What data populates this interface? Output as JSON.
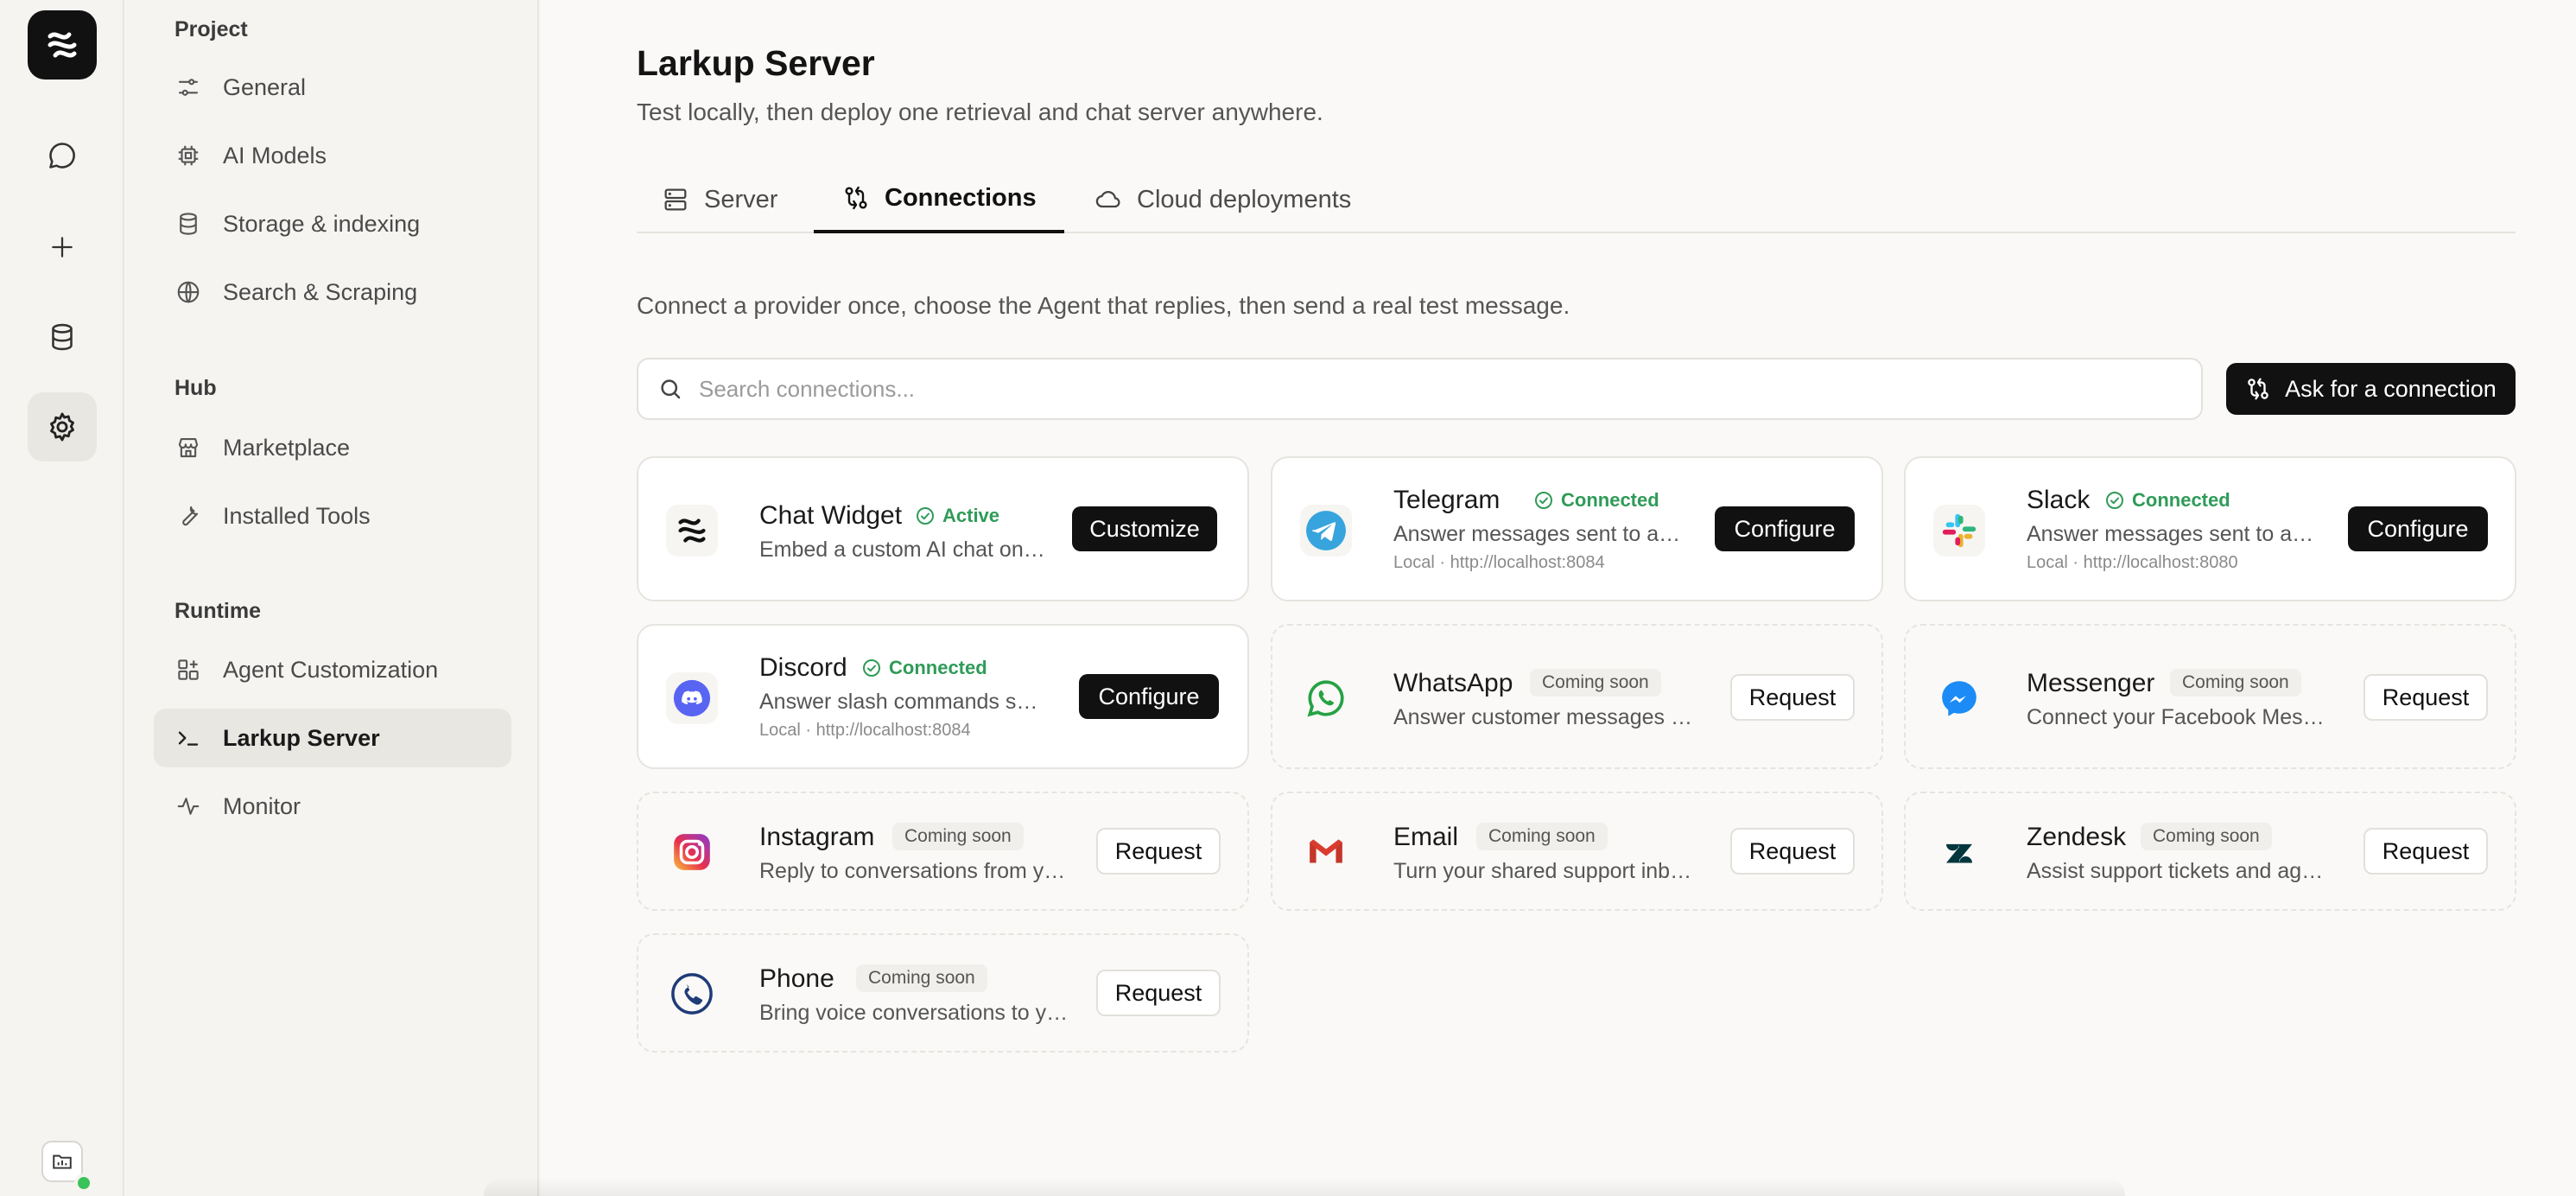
{
  "rail": {
    "icons": [
      "app-logo",
      "chat-icon",
      "plus-icon",
      "database-icon",
      "gear-icon",
      "folder-status-icon"
    ]
  },
  "sidebar": {
    "sections": [
      {
        "title": "Project",
        "items": [
          "General",
          "AI Models",
          "Storage & indexing",
          "Search & Scraping"
        ]
      },
      {
        "title": "Hub",
        "items": [
          "Marketplace",
          "Installed Tools"
        ]
      },
      {
        "title": "Runtime",
        "items": [
          "Agent Customization",
          "Larkup Server",
          "Monitor"
        ]
      }
    ],
    "active": "Larkup Server"
  },
  "header": {
    "title": "Larkup Server",
    "subtitle": "Test locally, then deploy one retrieval and chat server anywhere."
  },
  "tabs": [
    {
      "label": "Server",
      "icon": "server-icon"
    },
    {
      "label": "Connections",
      "icon": "connections-icon",
      "active": true
    },
    {
      "label": "Cloud deployments",
      "icon": "cloud-icon"
    }
  ],
  "intro": "Connect a provider once, choose the Agent that replies, then send a real test message.",
  "search": {
    "placeholder": "Search connections..."
  },
  "ask_button": "Ask for a connection",
  "cards": [
    {
      "name": "Chat Widget",
      "status": "Active",
      "desc": "Embed a custom AI chat on your website",
      "action": "Customize"
    },
    {
      "name": "Telegram",
      "status": "Connected",
      "desc": "Answer messages sent to a Telegram bot",
      "meta": "Local · http://localhost:8084",
      "action": "Configure"
    },
    {
      "name": "Slack",
      "status": "Connected",
      "desc": "Answer messages sent to a Slack workspace",
      "meta": "Local · http://localhost:8080",
      "action": "Configure"
    },
    {
      "name": "Discord",
      "status": "Connected",
      "desc": "Answer slash commands sent in Discord",
      "meta": "Local · http://localhost:8084",
      "action": "Configure"
    },
    {
      "name": "WhatsApp",
      "status": "Coming soon",
      "desc": "Answer customer messages through WhatsApp",
      "action": "Request"
    },
    {
      "name": "Messenger",
      "status": "Coming soon",
      "desc": "Connect your Facebook Messenger page",
      "action": "Request"
    },
    {
      "name": "Instagram",
      "status": "Coming soon",
      "desc": "Reply to conversations from your Instagram",
      "action": "Request"
    },
    {
      "name": "Email",
      "status": "Coming soon",
      "desc": "Turn your shared support inbox into replies",
      "action": "Request"
    },
    {
      "name": "Zendesk",
      "status": "Coming soon",
      "desc": "Assist support tickets and agents",
      "action": "Request"
    },
    {
      "name": "Phone",
      "status": "Coming soon",
      "desc": "Bring voice conversations to your Agent",
      "action": "Request"
    }
  ],
  "colors": {
    "accent": "#111111",
    "success": "#2f9b58",
    "background": "#faf9f7"
  }
}
